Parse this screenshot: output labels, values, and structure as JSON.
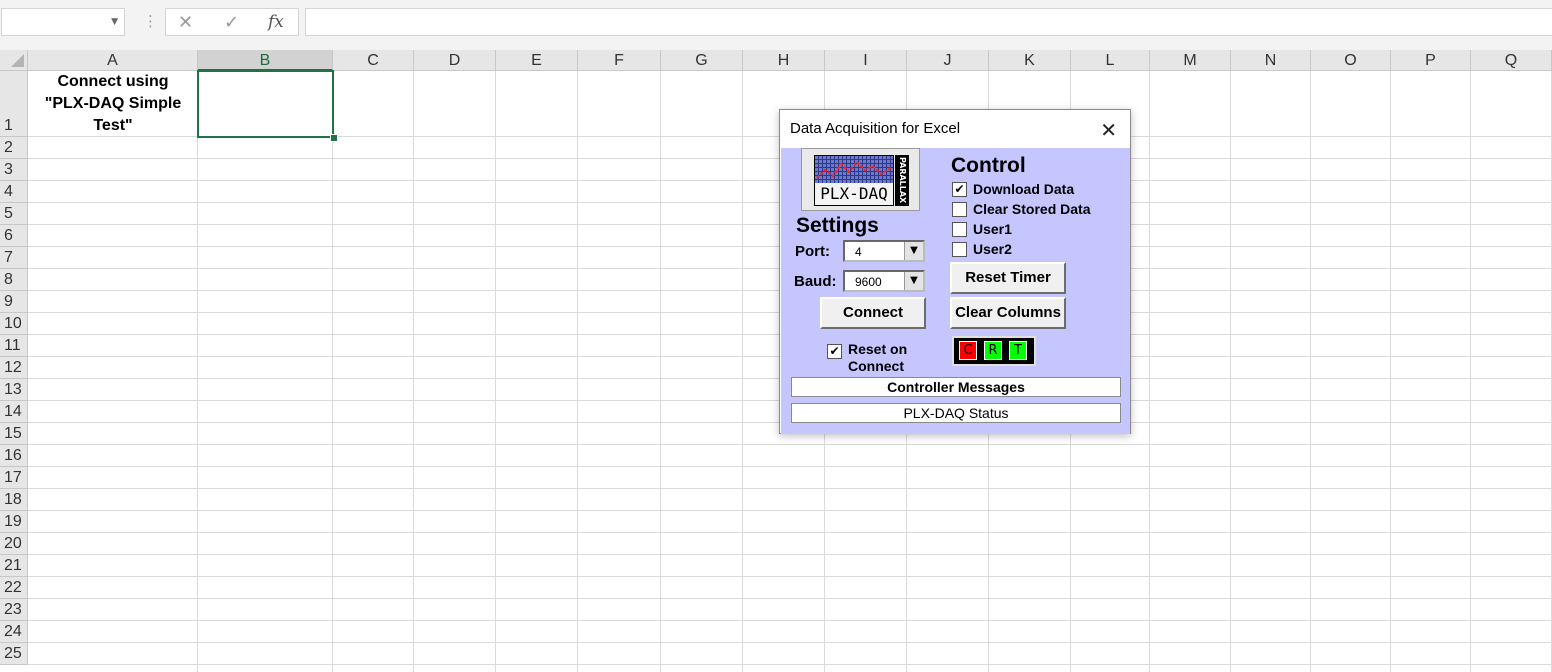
{
  "formula_bar": {
    "name_box_value": "",
    "cancel_icon": "✕",
    "enter_icon": "✓",
    "fx_label": "fx",
    "formula_value": ""
  },
  "columns": [
    "A",
    "B",
    "C",
    "D",
    "E",
    "F",
    "G",
    "H",
    "I",
    "J",
    "K",
    "L",
    "M",
    "N",
    "O",
    "P",
    "Q"
  ],
  "selected_column": "B",
  "rows": [
    "1",
    "2",
    "3",
    "4",
    "5",
    "6",
    "7",
    "8",
    "9",
    "10",
    "11",
    "12",
    "13",
    "14",
    "15",
    "16",
    "17",
    "18",
    "19",
    "20",
    "21",
    "22",
    "23",
    "24",
    "25"
  ],
  "cells": {
    "a1": "Connect using\n\"PLX-DAQ Simple\nTest\""
  },
  "dialog": {
    "title": "Data Acquisition for Excel",
    "close_icon": "✕",
    "logo_text": "PLX-DAQ",
    "logo_side_text": "PARALLAX",
    "settings": {
      "heading": "Settings",
      "port_label": "Port:",
      "port_value": "4",
      "baud_label": "Baud:",
      "baud_value": "9600",
      "connect_label": "Connect",
      "reset_on_connect_label": "Reset on Connect",
      "reset_on_connect_checked": true
    },
    "control": {
      "heading": "Control",
      "checkboxes": [
        {
          "label": "Download Data",
          "checked": true
        },
        {
          "label": "Clear Stored Data",
          "checked": false
        },
        {
          "label": "User1",
          "checked": false
        },
        {
          "label": "User2",
          "checked": false
        }
      ],
      "reset_timer_label": "Reset Timer",
      "clear_columns_label": "Clear Columns",
      "indicators": [
        {
          "letter": "C",
          "color": "#ff0000"
        },
        {
          "letter": "R",
          "color": "#00ff00"
        },
        {
          "letter": "T",
          "color": "#00ff00"
        }
      ]
    },
    "controller_messages": "Controller Messages",
    "status": "PLX-DAQ Status"
  },
  "colors": {
    "dialog_body": "#c6c6fe",
    "selection": "#217346"
  }
}
